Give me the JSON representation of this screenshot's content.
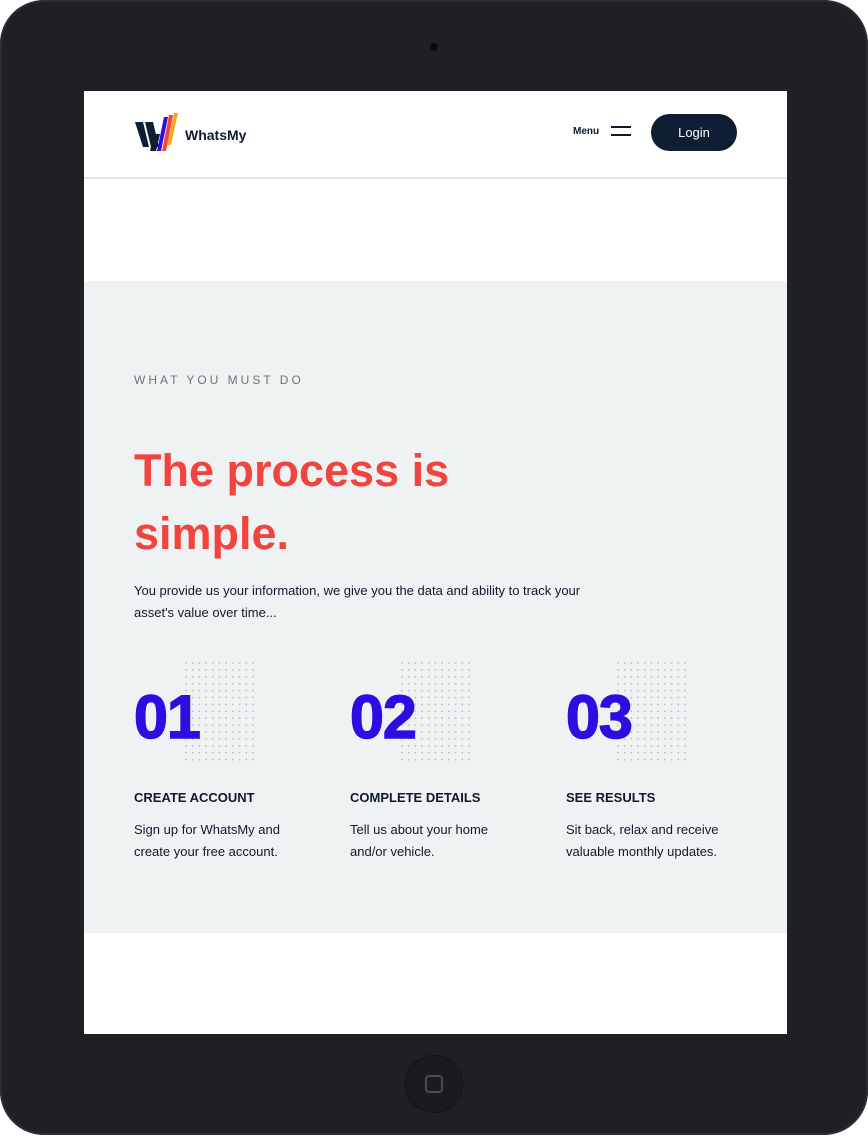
{
  "header": {
    "logo_text": "WhatsMy",
    "menu_label": "Menu",
    "login_label": "Login"
  },
  "process": {
    "eyebrow": "WHAT YOU MUST DO",
    "heading": "The process is simple.",
    "intro": "You provide us your information, we give you the data and ability to track your asset's value over time...",
    "steps": [
      {
        "number": "01",
        "title": "CREATE ACCOUNT",
        "text": "Sign up for WhatsMy and create your free account."
      },
      {
        "number": "02",
        "title": "COMPLETE DETAILS",
        "text": "Tell us about your home and/or vehicle."
      },
      {
        "number": "03",
        "title": "SEE RESULTS",
        "text": "Sit back, relax and receive valuable monthly updates."
      }
    ]
  },
  "icons": {
    "logo": "whatsmy-logo-icon",
    "menu": "hamburger-icon",
    "home": "home-button-icon"
  },
  "colors": {
    "navy": "#0f1e33",
    "accent_red": "#f2443f",
    "accent_blue": "#2a0fe0",
    "section_bg": "#eff2f3",
    "device_frame": "#1f2024"
  }
}
